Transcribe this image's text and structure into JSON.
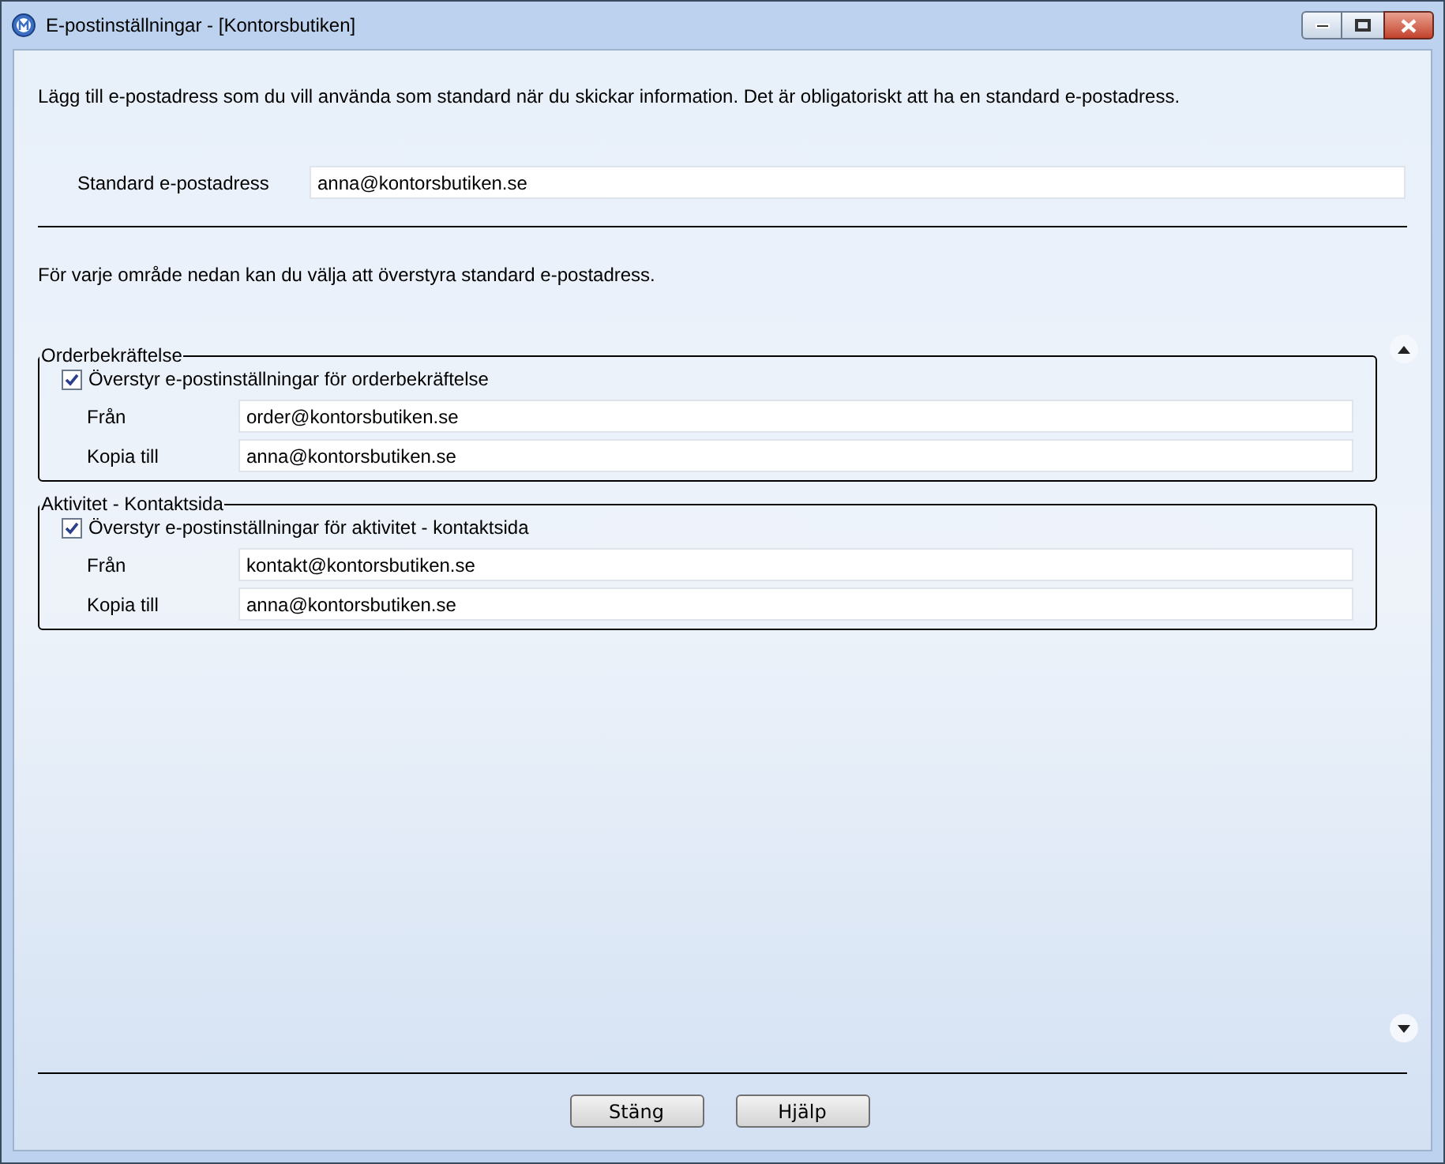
{
  "window": {
    "title": "E-postinställningar - [Kontorsbutiken]"
  },
  "intro": "Lägg till e-postadress som du vill använda som standard när du skickar information. Det är obligatoriskt att ha en standard e-postadress.",
  "standard": {
    "label": "Standard e-postadress",
    "value": "anna@kontorsbutiken.se"
  },
  "override_intro": "För varje område nedan kan du välja att överstyra standard e-postadress.",
  "groups": [
    {
      "title": "Orderbekräftelse",
      "checkbox": {
        "label": "Överstyr e-postinställningar för orderbekräftelse",
        "checked": true
      },
      "fields": [
        {
          "label": "Från",
          "value": "order@kontorsbutiken.se"
        },
        {
          "label": "Kopia till",
          "value": "anna@kontorsbutiken.se"
        }
      ]
    },
    {
      "title": "Aktivitet - Kontaktsida",
      "checkbox": {
        "label": "Överstyr e-postinställningar för aktivitet - kontaktsida",
        "checked": true
      },
      "fields": [
        {
          "label": "Från",
          "value": "kontakt@kontorsbutiken.se"
        },
        {
          "label": "Kopia till",
          "value": "anna@kontorsbutiken.se"
        }
      ]
    }
  ],
  "buttons": [
    "Stäng",
    "Hjälp"
  ]
}
